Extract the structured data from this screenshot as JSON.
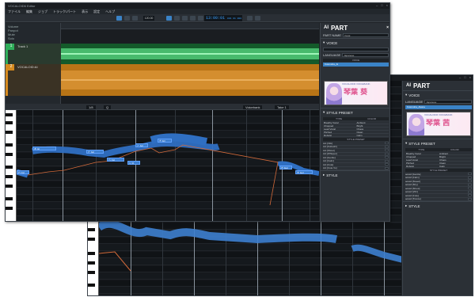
{
  "app": {
    "title": "VOCALOID6 Editor"
  },
  "menu": [
    "ファイル",
    "編集",
    "ジョブ",
    "トラック/パート",
    "表示",
    "設定",
    "ヘルプ"
  ],
  "transport": {
    "time": "13:00:01",
    "pos": "001 01 000",
    "tempo": "120.00"
  },
  "tracks": [
    {
      "num": "1",
      "name": "Track 1",
      "type": "audio"
    },
    {
      "num": "2",
      "name": "VOCALOID:AI",
      "type": "vocaloid"
    }
  ],
  "track_params": [
    "Volume",
    "Panpot",
    "Mute",
    "Solo"
  ],
  "editor": {
    "tool_labels": [
      "1/8",
      "Q",
      "Voicebank",
      "Take 1"
    ]
  },
  "notes": [
    {
      "id": "n1",
      "lyric": "あ [a]"
    },
    {
      "id": "n2",
      "lyric": "た [ta]"
    },
    {
      "id": "n3",
      "lyric": "ら [ra]"
    },
    {
      "id": "n4",
      "lyric": "い [i]"
    },
    {
      "id": "n5",
      "lyric": "と [to]"
    },
    {
      "id": "n6",
      "lyric": "き [ki]"
    },
    {
      "id": "n7",
      "lyric": "れ [re]"
    },
    {
      "id": "n8",
      "lyric": "か [ka]"
    },
    {
      "id": "n9",
      "lyric": "す [su]"
    }
  ],
  "panel": {
    "badge": "AI",
    "title": "PART",
    "part_name_label": "PART NAME",
    "part_name_value": "Vocal",
    "voice_section": "VOICE",
    "language_label": "LANGUAGE",
    "language_value": "Japanese",
    "voice_dropdown": "VOICE",
    "voice_selected_1": "Kotonoha_Ai",
    "voice_selected_2": "Kotonoha_Akane",
    "banner_tag": "VOCALOID6 VOICEBANK",
    "banner_title_1": "琴葉 葵",
    "banner_title_2": "琴葉 茜",
    "style_preset_section": "STYLE PRESET",
    "type_label": "TYPE",
    "color_label": "COLOR",
    "presets": [
      "Breathy Vocal",
      "Ambient",
      "Chopped",
      "Bright",
      "Lead Vocal",
      "Chaos",
      "Pitched",
      "Clean",
      "Robotic",
      "Calm"
    ],
    "style_preset_label": "STYLE PRESET",
    "styles_1": [
      "Act [Vibr]",
      "Act [Kobushi]",
      "Act [Shout]",
      "Act [Whisper]",
      "Act [Gentle]",
      "Act [Calm]",
      "Act [Cute]",
      "Act [Cute Vo]"
    ],
    "styles_2": [
      "aoioid [Gentle]",
      "aoioid [Calm]",
      "aoioid [Sweet]",
      "aoioid [Shy]",
      "aoioid [Shout]",
      "aoioid [Vibr]",
      "aoioid [Cute]",
      "aoioid [Trance]"
    ],
    "style_section": "STYLE"
  }
}
